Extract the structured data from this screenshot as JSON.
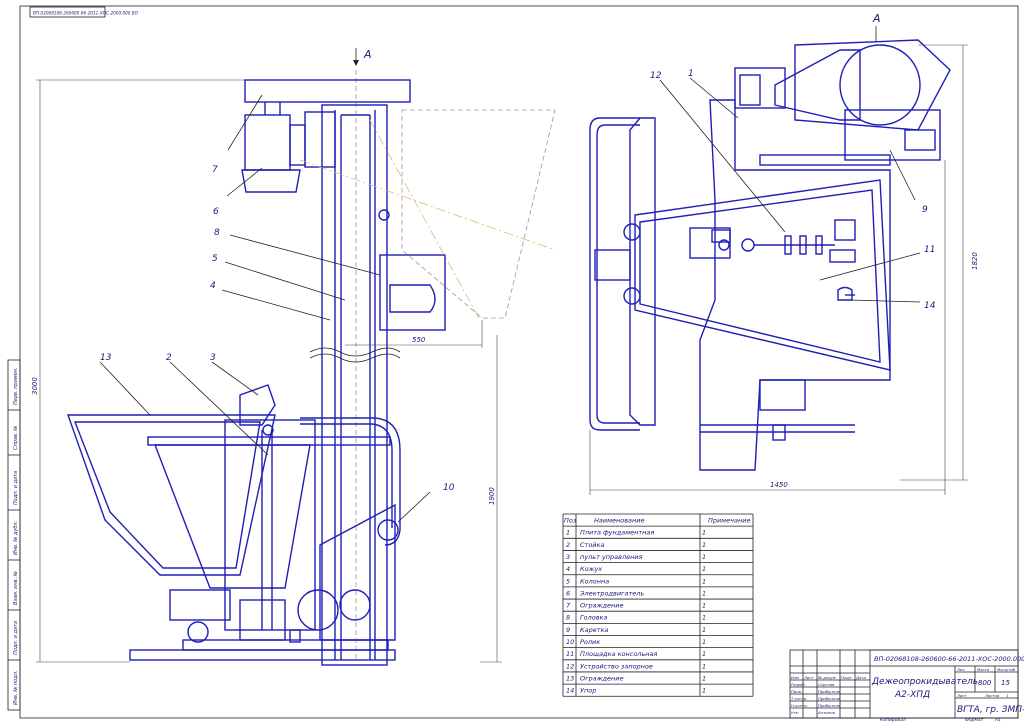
{
  "header_stamp": "ВП-02068108-260600-66-2011-ХОС-2000.000 ВО",
  "left_view": {
    "section_label": "A",
    "dim_width": "550",
    "dim_height_total": "3000",
    "dim_height_lower": "1900",
    "callouts": [
      "7",
      "6",
      "8",
      "5",
      "4",
      "13",
      "2",
      "3",
      "10"
    ]
  },
  "right_view": {
    "section_label": "A",
    "dim_width": "1450",
    "dim_height": "1820",
    "callouts": [
      "12",
      "1",
      "9",
      "11",
      "14"
    ]
  },
  "parts_table": {
    "headers": [
      "Поз",
      "Наименование",
      "Примечание"
    ],
    "rows": [
      {
        "pos": "1",
        "name": "Плита фундаментная",
        "qty": "1"
      },
      {
        "pos": "2",
        "name": "Стойка",
        "qty": "1"
      },
      {
        "pos": "3",
        "name": "пульт управления",
        "qty": "1"
      },
      {
        "pos": "4",
        "name": "Кожух",
        "qty": "1"
      },
      {
        "pos": "5",
        "name": "Колонна",
        "qty": "1"
      },
      {
        "pos": "6",
        "name": "Электродвигатель",
        "qty": "1"
      },
      {
        "pos": "7",
        "name": "Ограждение",
        "qty": "1"
      },
      {
        "pos": "8",
        "name": "Головка",
        "qty": "1"
      },
      {
        "pos": "9",
        "name": "Каретка",
        "qty": "1"
      },
      {
        "pos": "10",
        "name": "Ролик",
        "qty": "1"
      },
      {
        "pos": "11",
        "name": "Площадка консольная",
        "qty": "1"
      },
      {
        "pos": "12",
        "name": "Устройство запорное",
        "qty": "1"
      },
      {
        "pos": "13",
        "name": "Ограждение",
        "qty": "1"
      },
      {
        "pos": "14",
        "name": "Упор",
        "qty": "1"
      }
    ]
  },
  "title_block": {
    "code": "ВП-02068108-260600-66-2011-ХОС-2000.000 ВО",
    "title_line1": "Дежеопрокидыватель",
    "title_line2": "А2-ХПД",
    "mass": "800",
    "scale": "15",
    "org": "ВГТА, гр. ЗМП-4",
    "col_lit": "Лит.",
    "col_mass": "Масса",
    "col_scale": "Масштаб",
    "sheet": "Лист",
    "sheets": "Листов",
    "sheets_count": "1",
    "roles": [
      "Разраб.",
      "Пров.",
      "Т.контр.",
      "Н.контр.",
      "Утв."
    ],
    "names": [
      "Сорочев",
      "Прибытков",
      "Прибытков",
      "Прибытков",
      "Антипов"
    ],
    "header_cells": [
      "Изм",
      "Лист",
      "№ докум.",
      "Подп.",
      "Дата"
    ],
    "copied": "Копировал",
    "format": "Формат",
    "format_value": "А1"
  },
  "side_stamps": [
    "Перв. примен.",
    "Справ. №",
    "Подп. и дата",
    "Инв. № дубл.",
    "Взам. инв. №",
    "Подп. и дата",
    "Инв. № подл."
  ]
}
